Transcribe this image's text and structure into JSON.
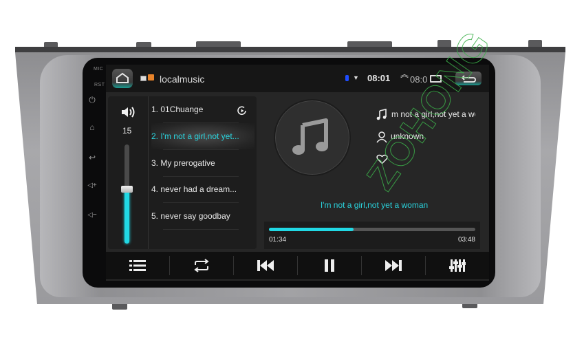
{
  "device": {
    "hw_labels": {
      "mic": "MIC",
      "rst": "RST"
    },
    "hw_buttons": [
      {
        "name": "power-icon",
        "glyph": "⏻"
      },
      {
        "name": "home-icon",
        "glyph": "⌂"
      },
      {
        "name": "back-icon",
        "glyph": "↩"
      },
      {
        "name": "volume-up-icon",
        "glyph": "◁+"
      },
      {
        "name": "volume-down-icon",
        "glyph": "◁−"
      }
    ],
    "watermark": "ZOHONG"
  },
  "statusbar": {
    "app_title": "localmusic",
    "time": "08:01",
    "secondary_time": "08:0",
    "icons": {
      "home": "home-icon",
      "back": "back-icon",
      "bluetooth": "bluetooth-icon",
      "wifi": "wifi-icon",
      "recents": "recents-icon",
      "chevron_up": "chevron-up-icon"
    }
  },
  "volume": {
    "level": "15",
    "fraction": 0.55
  },
  "playlist": {
    "items": [
      {
        "label": "1. 01Chuange",
        "active": false
      },
      {
        "label": "2. I'm not a girl,not yet...",
        "active": true
      },
      {
        "label": "3. My prerogative",
        "active": false
      },
      {
        "label": "4. never had a dream...",
        "active": false
      },
      {
        "label": "5. never say goodbay",
        "active": false
      }
    ]
  },
  "now_playing": {
    "title": "m not a girl,not yet a wo",
    "artist": "unknown",
    "lyric": "I'm not a girl,not yet a woman",
    "elapsed": "01:34",
    "duration": "03:48",
    "progress_fraction": 0.41
  },
  "controls": [
    {
      "name": "playlist-button",
      "icon": "list-icon"
    },
    {
      "name": "repeat-button",
      "icon": "repeat-icon"
    },
    {
      "name": "previous-button",
      "icon": "previous-icon"
    },
    {
      "name": "pause-button",
      "icon": "pause-icon"
    },
    {
      "name": "next-button",
      "icon": "next-icon"
    },
    {
      "name": "equalizer-button",
      "icon": "equalizer-icon"
    }
  ],
  "colors": {
    "accent": "#21d8e4",
    "accent_text": "#2ad3dd",
    "screen_bg": "#262626"
  }
}
